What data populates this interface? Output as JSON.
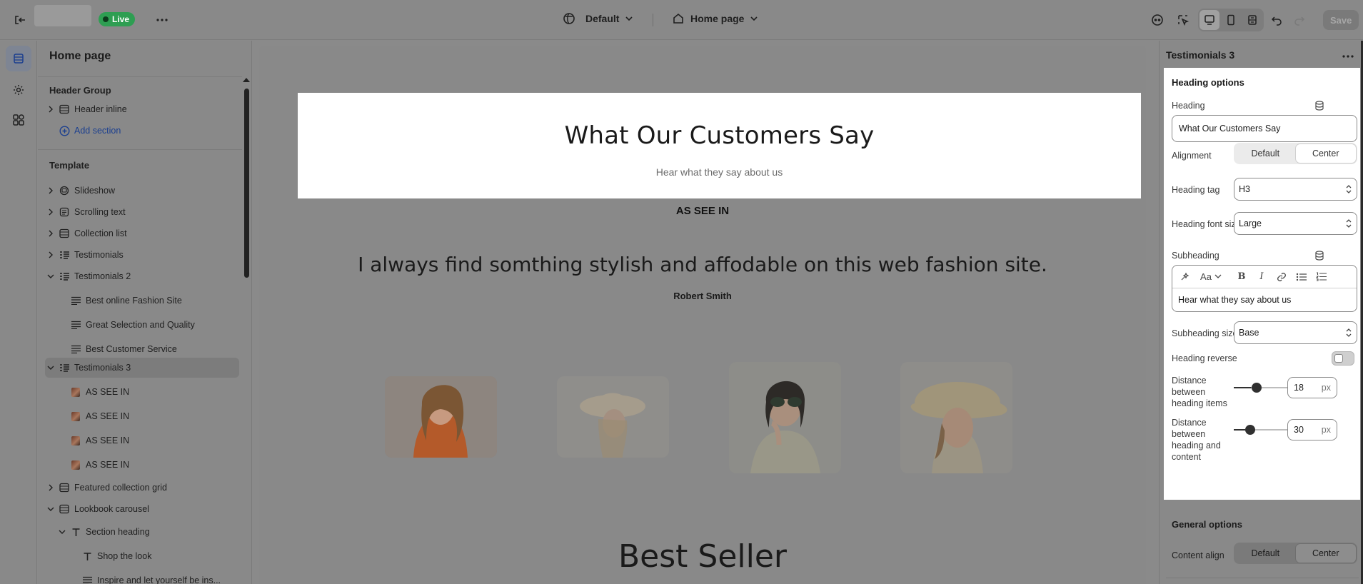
{
  "topbar": {
    "live_label": "Live",
    "theme_label": "Default",
    "page_label": "Home page",
    "save_label": "Save"
  },
  "sidebar": {
    "title": "Home page",
    "header_group_label": "Header Group",
    "header_items": [
      {
        "label": "Header inline",
        "icon": "section-icon"
      }
    ],
    "add_section_label": "Add section",
    "template_label": "Template",
    "items": [
      {
        "label": "Slideshow",
        "icon": "slideshow-icon"
      },
      {
        "label": "Scrolling text",
        "icon": "scrolling-text-icon"
      },
      {
        "label": "Collection list",
        "icon": "section-icon"
      },
      {
        "label": "Testimonials",
        "icon": "testimonials-icon"
      },
      {
        "label": "Testimonials 2",
        "icon": "testimonials-icon"
      },
      {
        "label": "Best online Fashion Site",
        "icon": "text-block-icon"
      },
      {
        "label": "Great Selection and Quality",
        "icon": "text-block-icon"
      },
      {
        "label": "Best Customer Service",
        "icon": "text-block-icon"
      },
      {
        "label": "Testimonials 3",
        "icon": "testimonials-icon"
      },
      {
        "label": "AS SEE IN",
        "icon": "image-thumb-icon"
      },
      {
        "label": "AS SEE IN",
        "icon": "image-thumb-icon"
      },
      {
        "label": "AS SEE IN",
        "icon": "image-thumb-icon"
      },
      {
        "label": "AS SEE IN",
        "icon": "image-thumb-icon"
      },
      {
        "label": "Featured collection grid",
        "icon": "section-icon"
      },
      {
        "label": "Lookbook carousel",
        "icon": "section-icon"
      },
      {
        "label": "Section heading",
        "icon": "text-icon"
      },
      {
        "label": "Shop the look",
        "icon": "text-icon"
      },
      {
        "label": "Inspire and let yourself be ins...",
        "icon": "text-block-icon"
      }
    ]
  },
  "preview": {
    "heading": "What Our Customers Say",
    "subheading": "Hear what they say about us",
    "block_title": "AS SEE IN",
    "quote": "I always find somthing stylish and affodable on this web fashion site.",
    "author": "Robert Smith",
    "next_heading": "Best Seller"
  },
  "panel": {
    "title": "Testimonials 3",
    "heading_options_label": "Heading options",
    "heading_label": "Heading",
    "heading_value": "What Our Customers Say",
    "alignment_label": "Alignment",
    "alignment_options": [
      "Default",
      "Center"
    ],
    "alignment_selected": "Center",
    "heading_tag_label": "Heading tag",
    "heading_tag_value": "H3",
    "heading_font_size_label": "Heading font size",
    "heading_font_size_value": "Large",
    "subheading_label": "Subheading",
    "subheading_value": "Hear what they say about us",
    "subheading_size_label": "Subheading size",
    "subheading_size_value": "Base",
    "heading_reverse_label": "Heading reverse",
    "heading_reverse_on": false,
    "distance_items_label": "Distance between heading items",
    "distance_items_value": "18",
    "distance_items_unit": "px",
    "distance_content_label": "Distance between heading and content",
    "distance_content_value": "30",
    "distance_content_unit": "px",
    "general_options_label": "General options",
    "content_align_label": "Content align",
    "content_align_options": [
      "Default",
      "Center"
    ],
    "content_align_selected": "Center"
  },
  "colors": {
    "live_green": "#2e9e52",
    "link_blue": "#1b3f8f",
    "overlay_gray": "#898989"
  }
}
